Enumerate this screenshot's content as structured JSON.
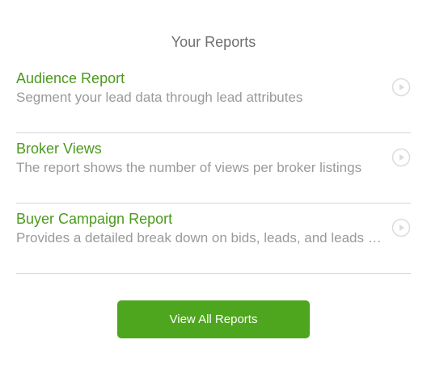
{
  "header": {
    "title": "Your Reports"
  },
  "reports": [
    {
      "name": "Audience Report",
      "description": "Segment your lead data through lead attributes",
      "icon": "play-circle-icon"
    },
    {
      "name": "Broker Views",
      "description": "The report shows the number of views per broker listings",
      "icon": "play-circle-icon"
    },
    {
      "name": "Buyer Campaign Report",
      "description": "Provides a detailed break down on bids, leads, and leads sold",
      "icon": "play-circle-icon"
    }
  ],
  "footer": {
    "view_all_label": "View All Reports"
  },
  "colors": {
    "accent": "#4ea61e",
    "link": "#4c9a1d",
    "muted_text": "#9a9a9a",
    "divider": "#d6d6d6"
  }
}
